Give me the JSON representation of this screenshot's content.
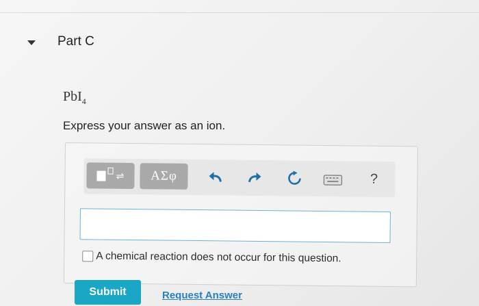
{
  "part": {
    "title": "Part C"
  },
  "question": {
    "formula_base": "PbI",
    "formula_subscript": "4",
    "instruction": "Express your answer as an ion."
  },
  "toolbar": {
    "symbols_label": "ΑΣφ",
    "help_label": "?",
    "icons": [
      "templates-icon",
      "undo-icon",
      "redo-icon",
      "reset-icon",
      "keyboard-icon",
      "help-icon"
    ]
  },
  "answer": {
    "value": "",
    "no_reaction_label": "A chemical reaction does not occur for this question."
  },
  "actions": {
    "submit_label": "Submit",
    "request_answer_label": "Request Answer"
  },
  "colors": {
    "submit": "#1aa7c5",
    "link": "#2a7fc0",
    "input_border": "#6fb2d1",
    "tool_button": "#a9a9a9"
  }
}
